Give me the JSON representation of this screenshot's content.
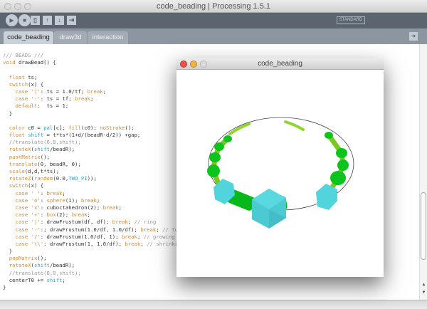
{
  "window": {
    "title": "code_beading | Processing 1.5.1"
  },
  "toolbar": {
    "mode_label": "STANDARD",
    "buttons": [
      "run",
      "stop",
      "new",
      "open",
      "save",
      "export"
    ]
  },
  "tabs": [
    {
      "label": "code_beading",
      "active": true
    },
    {
      "label": "draw3d"
    },
    {
      "label": "interaction"
    }
  ],
  "sketch_window": {
    "title": "code_beading",
    "colors": {
      "cyan": "#4fd0d8",
      "green": "#0cc41c",
      "lime": "#8ed62a"
    }
  },
  "colors": {
    "keyword": "#d88a2e",
    "constant": "#3a9fd0",
    "comment": "#9a9a9a",
    "toolbar": "#5b6570",
    "tabrow": "#8c96a0"
  },
  "code": [
    [
      [
        "c",
        "/// BEADS ///"
      ]
    ],
    [
      [
        "k",
        "void"
      ],
      [
        "n",
        " drawBead() {"
      ]
    ],
    [],
    [
      [
        "n",
        "  "
      ],
      [
        "k",
        "float"
      ],
      [
        "n",
        " ts;"
      ]
    ],
    [
      [
        "n",
        "  "
      ],
      [
        "k",
        "switch"
      ],
      [
        "n",
        "(x) {"
      ]
    ],
    [
      [
        "n",
        "    "
      ],
      [
        "k",
        "case"
      ],
      [
        "n",
        " "
      ],
      [
        "k",
        "'|'"
      ],
      [
        "n",
        ": ts = 1.0/tf; "
      ],
      [
        "k",
        "break"
      ],
      [
        "n",
        ";"
      ]
    ],
    [
      [
        "n",
        "    "
      ],
      [
        "k",
        "case"
      ],
      [
        "n",
        " "
      ],
      [
        "k",
        "'-'"
      ],
      [
        "n",
        ": ts = tf; "
      ],
      [
        "k",
        "break"
      ],
      [
        "n",
        ";"
      ]
    ],
    [
      [
        "n",
        "    "
      ],
      [
        "k",
        "default"
      ],
      [
        "n",
        ":  ts = 1;"
      ]
    ],
    [
      [
        "n",
        "  }"
      ]
    ],
    [],
    [
      [
        "n",
        "  "
      ],
      [
        "k",
        "color"
      ],
      [
        "n",
        " c0 = "
      ],
      [
        "b",
        "pal"
      ],
      [
        "n",
        "[c]; "
      ],
      [
        "k",
        "fill"
      ],
      [
        "n",
        "(c0); "
      ],
      [
        "k",
        "noStroke"
      ],
      [
        "n",
        "();"
      ]
    ],
    [
      [
        "n",
        "  "
      ],
      [
        "k",
        "float"
      ],
      [
        "n",
        " "
      ],
      [
        "b",
        "shift"
      ],
      [
        "n",
        " = t*ts*(1+d/(beadR-d/2)) +gap;"
      ]
    ],
    [
      [
        "c",
        "  //translate(0,0,shift);"
      ]
    ],
    [
      [
        "n",
        "  "
      ],
      [
        "k",
        "rotateX"
      ],
      [
        "n",
        "("
      ],
      [
        "b",
        "shift"
      ],
      [
        "n",
        "/beadR);"
      ]
    ],
    [
      [
        "n",
        "  "
      ],
      [
        "k",
        "pushMatrix"
      ],
      [
        "n",
        "();"
      ]
    ],
    [
      [
        "n",
        "  "
      ],
      [
        "k",
        "translate"
      ],
      [
        "n",
        "(0, beadR, 0);"
      ]
    ],
    [
      [
        "n",
        "  "
      ],
      [
        "k",
        "scale"
      ],
      [
        "n",
        "(d,d,t*ts);"
      ]
    ],
    [
      [
        "n",
        "  "
      ],
      [
        "k",
        "rotateZ"
      ],
      [
        "n",
        "("
      ],
      [
        "k",
        "random"
      ],
      [
        "n",
        "(0.0,"
      ],
      [
        "b",
        "TWO_PI"
      ],
      [
        "n",
        "));"
      ]
    ],
    [
      [
        "n",
        "  "
      ],
      [
        "k",
        "switch"
      ],
      [
        "n",
        "(x) {"
      ]
    ],
    [
      [
        "n",
        "    "
      ],
      [
        "k",
        "case"
      ],
      [
        "n",
        " "
      ],
      [
        "k",
        "' '"
      ],
      [
        "n",
        ": "
      ],
      [
        "k",
        "break"
      ],
      [
        "n",
        ";"
      ]
    ],
    [
      [
        "n",
        "    "
      ],
      [
        "k",
        "case"
      ],
      [
        "n",
        " "
      ],
      [
        "k",
        "'o'"
      ],
      [
        "n",
        ": "
      ],
      [
        "k",
        "sphere"
      ],
      [
        "n",
        "(1); "
      ],
      [
        "k",
        "break"
      ],
      [
        "n",
        ";"
      ]
    ],
    [
      [
        "n",
        "    "
      ],
      [
        "k",
        "case"
      ],
      [
        "n",
        " "
      ],
      [
        "k",
        "'x'"
      ],
      [
        "n",
        ": cuboctahedron(2); "
      ],
      [
        "k",
        "break"
      ],
      [
        "n",
        ";"
      ]
    ],
    [
      [
        "n",
        "    "
      ],
      [
        "k",
        "case"
      ],
      [
        "n",
        " "
      ],
      [
        "k",
        "'+'"
      ],
      [
        "n",
        ": "
      ],
      [
        "k",
        "box"
      ],
      [
        "n",
        "(2); "
      ],
      [
        "k",
        "break"
      ],
      [
        "n",
        ";"
      ]
    ],
    [
      [
        "n",
        "    "
      ],
      [
        "k",
        "case"
      ],
      [
        "n",
        " "
      ],
      [
        "k",
        "'|'"
      ],
      [
        "n",
        ": drawFrustum(df, df); "
      ],
      [
        "k",
        "break"
      ],
      [
        "n",
        "; "
      ],
      [
        "c",
        "// ring"
      ]
    ],
    [
      [
        "n",
        "    "
      ],
      [
        "k",
        "case"
      ],
      [
        "n",
        " "
      ],
      [
        "k",
        "'-'"
      ],
      [
        "n",
        ":; drawFrustum(1.0/df, 1.0/df); "
      ],
      [
        "k",
        "break"
      ],
      [
        "n",
        "; "
      ],
      [
        "c",
        "// tube"
      ]
    ],
    [
      [
        "n",
        "    "
      ],
      [
        "k",
        "case"
      ],
      [
        "n",
        " "
      ],
      [
        "k",
        "'/'"
      ],
      [
        "n",
        ": drawFrustum(1.0/df, 1); "
      ],
      [
        "k",
        "break"
      ],
      [
        "n",
        "; "
      ],
      [
        "c",
        "// growing"
      ]
    ],
    [
      [
        "n",
        "    "
      ],
      [
        "k",
        "case"
      ],
      [
        "n",
        " "
      ],
      [
        "k",
        "'\\\\'"
      ],
      [
        "n",
        ": drawFrustum(1, 1.0/df); "
      ],
      [
        "k",
        "break"
      ],
      [
        "n",
        "; "
      ],
      [
        "c",
        "// shrinking"
      ]
    ],
    [
      [
        "n",
        "  }"
      ]
    ],
    [
      [
        "n",
        "  "
      ],
      [
        "k",
        "popMatrix"
      ],
      [
        "n",
        "();"
      ]
    ],
    [
      [
        "n",
        "  "
      ],
      [
        "k",
        "rotateX"
      ],
      [
        "n",
        "("
      ],
      [
        "b",
        "shift"
      ],
      [
        "n",
        "/beadR);"
      ]
    ],
    [
      [
        "c",
        "  //translate(0,0,shift);"
      ]
    ],
    [
      [
        "n",
        "  centerT0 += "
      ],
      [
        "b",
        "shift"
      ],
      [
        "n",
        ";"
      ]
    ],
    [
      [
        "n",
        "}"
      ]
    ]
  ]
}
